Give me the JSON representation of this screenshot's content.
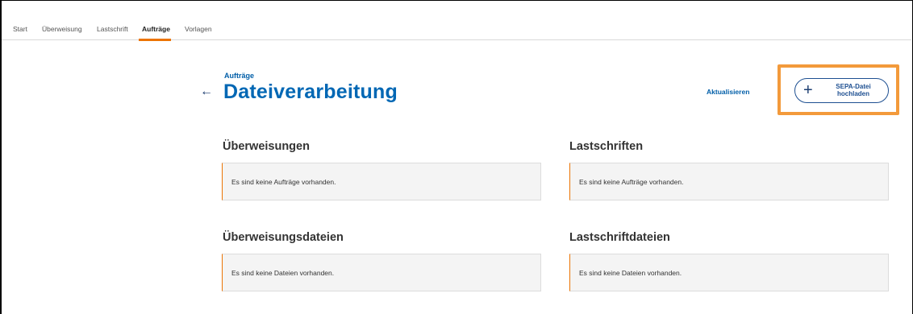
{
  "nav": {
    "tabs": [
      {
        "label": "Start",
        "active": false
      },
      {
        "label": "Überweisung",
        "active": false
      },
      {
        "label": "Lastschrift",
        "active": false
      },
      {
        "label": "Aufträge",
        "active": true
      },
      {
        "label": "Vorlagen",
        "active": false
      }
    ]
  },
  "header": {
    "back_icon": "←",
    "breadcrumb": "Aufträge",
    "title": "Dateiverarbeitung"
  },
  "actions": {
    "refresh_label": "Aktualisieren",
    "upload_icon": "+",
    "upload_label_line1": "SEPA-Datei",
    "upload_label_line2": "hochladen"
  },
  "sections": [
    {
      "title": "Überweisungen",
      "empty_text": "Es sind keine Aufträge vorhanden."
    },
    {
      "title": "Lastschriften",
      "empty_text": "Es sind keine Aufträge vorhanden."
    },
    {
      "title": "Überweisungsdateien",
      "empty_text": "Es sind keine Dateien vorhanden."
    },
    {
      "title": "Lastschriftdateien",
      "empty_text": "Es sind keine Dateien vorhanden."
    }
  ],
  "colors": {
    "accent_orange": "#ec7404",
    "highlight_orange": "#f39a3b",
    "brand_blue": "#0067b4",
    "button_border": "#1d4f91"
  }
}
